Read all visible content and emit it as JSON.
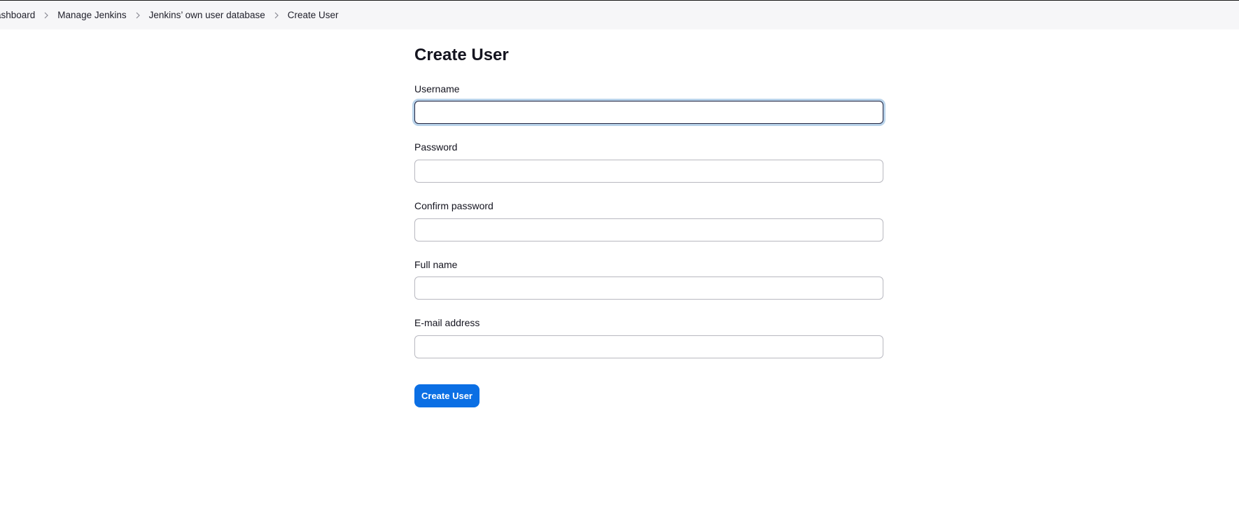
{
  "breadcrumb": {
    "items": [
      {
        "label": "ashboard"
      },
      {
        "label": "Manage Jenkins"
      },
      {
        "label": "Jenkins’ own user database"
      },
      {
        "label": "Create User"
      }
    ]
  },
  "form": {
    "title": "Create User",
    "username": {
      "label": "Username",
      "value": ""
    },
    "password": {
      "label": "Password",
      "value": ""
    },
    "confirm_password": {
      "label": "Confirm password",
      "value": ""
    },
    "full_name": {
      "label": "Full name",
      "value": ""
    },
    "email": {
      "label": "E-mail address",
      "value": ""
    },
    "submit_label": "Create User"
  },
  "colors": {
    "accent": "#0b6fe4",
    "breadcrumb_bg": "#f6f6f8",
    "focus_ring": "#b9d3ea"
  }
}
